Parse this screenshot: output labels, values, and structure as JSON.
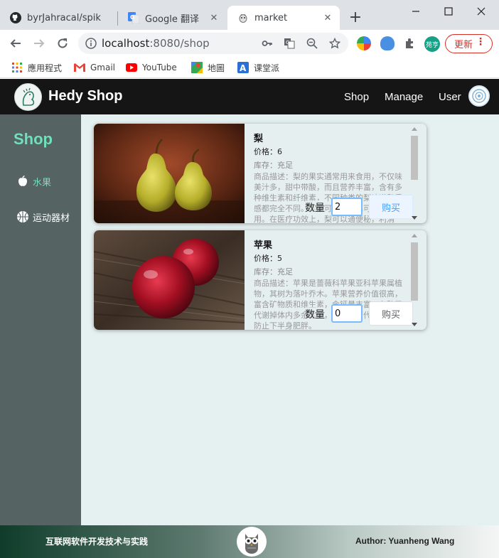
{
  "browser": {
    "tabs": [
      {
        "title": "byrJahracal/spik",
        "icon": "github-icon"
      },
      {
        "title": "Google 翻译",
        "icon": "google-translate-icon"
      },
      {
        "title": "market",
        "icon": "market-favicon"
      }
    ],
    "address": {
      "host": "localhost",
      "path": ":8080/shop"
    },
    "profile_label": "苑亨",
    "update_label": "更新",
    "bookmarks": [
      {
        "label": "應用程式",
        "icon": "apps-grid-icon"
      },
      {
        "label": "Gmail",
        "icon": "gmail-icon"
      },
      {
        "label": "YouTube",
        "icon": "youtube-icon"
      },
      {
        "label": "地圖",
        "icon": "maps-icon"
      },
      {
        "label": "课堂派",
        "icon": "ketangpai-icon"
      }
    ]
  },
  "header": {
    "brand": "Hedy Shop",
    "nav": [
      "Shop",
      "Manage",
      "User"
    ]
  },
  "sidebar": {
    "title": "Shop",
    "items": [
      {
        "label": "水果",
        "icon": "apple-icon",
        "active": true
      },
      {
        "label": "运动器材",
        "icon": "basketball-icon",
        "active": false
      }
    ]
  },
  "products": [
    {
      "name": "梨",
      "price": "价格：6",
      "stock": "库存：充足",
      "desc": "商品描述：梨的果实通常用来食用，不仅味美汁多，甜中带酸，而且营养丰富，含有多种维生素和纤维素，不同种类的梨味道和质感都完全不同。梨既可生食，也可蒸煮后食用。在医疗功效上，梨可以通便秘，利消化，对心血管也有好处。",
      "qty_label": "数量",
      "qty": "2",
      "buy_label": "购买"
    },
    {
      "name": "苹果",
      "price": "价格：5",
      "stock": "库存：充足",
      "desc": "商品描述：苹果是蔷薇科苹果亚科苹果属植物，其树为落叶乔木。苹果营养价值很高，富含矿物质和维生素，含钙量丰富，有助于代谢掉体内多余盐分，苹果酸可代谢热量，防止下半身肥胖。",
      "qty_label": "数量",
      "qty": "0",
      "buy_label": "购买"
    }
  ],
  "footer": {
    "title": "互联网软件开发技术与实践",
    "author": "Author: Yuanheng Wang"
  },
  "colors": {
    "header_bg": "#151515",
    "sidebar_bg": "#556363",
    "sidebar_accent": "#6fe0b9",
    "main_bg": "#e5f0f0",
    "buy_accent": "#409eff",
    "update_red": "#d93025"
  }
}
